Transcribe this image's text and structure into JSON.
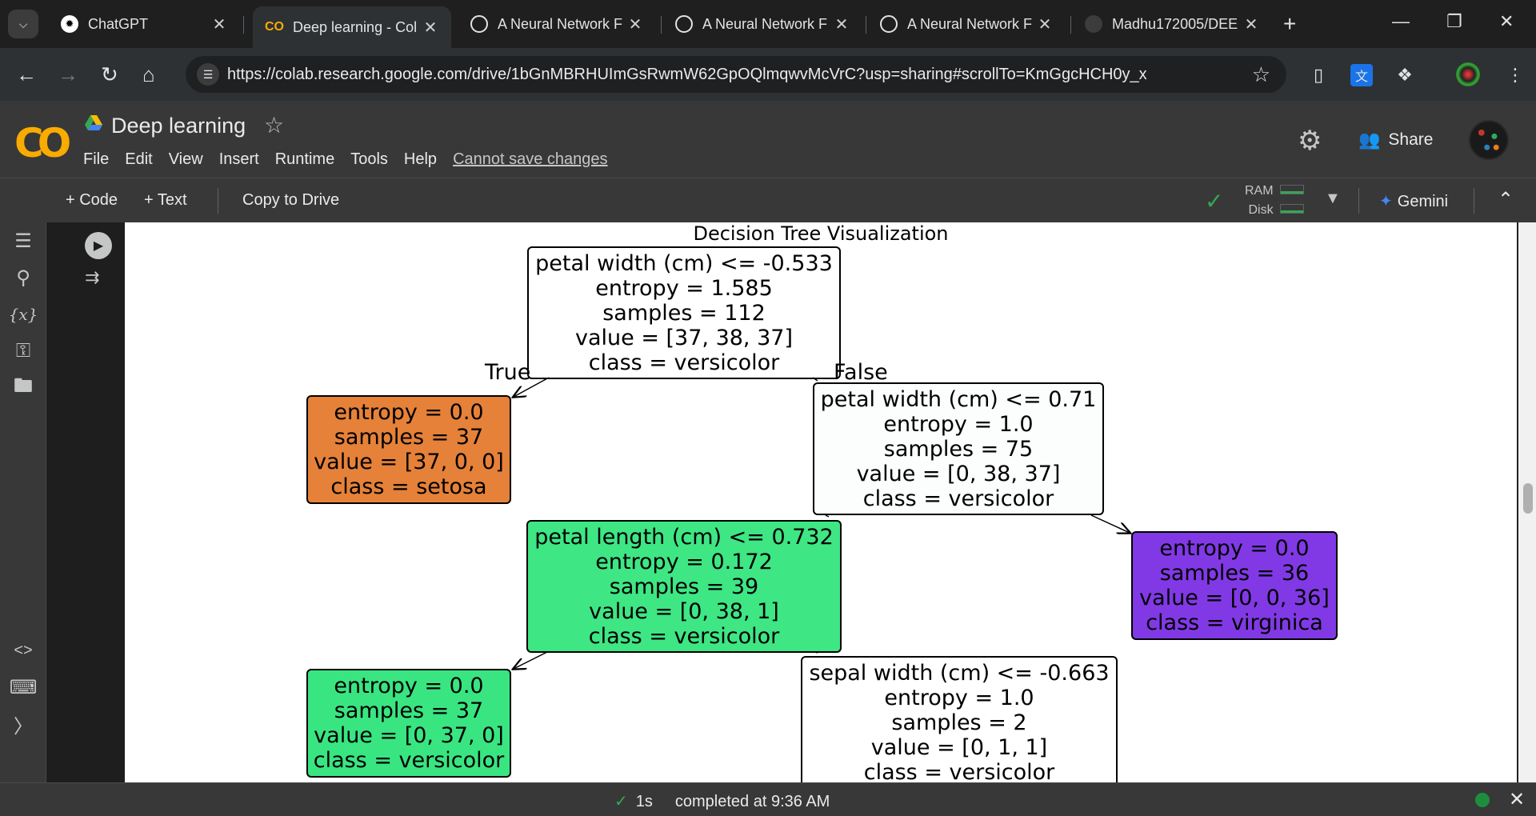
{
  "browser": {
    "tabs": [
      {
        "title": "ChatGPT",
        "icon": "chatgpt-icon",
        "active": false
      },
      {
        "title": "Deep learning - Col",
        "icon": "colab-icon",
        "active": true
      },
      {
        "title": "A Neural Network F",
        "icon": "spiral-icon",
        "active": false
      },
      {
        "title": "A Neural Network F",
        "icon": "spiral-icon",
        "active": false
      },
      {
        "title": "A Neural Network F",
        "icon": "spiral-icon",
        "active": false
      },
      {
        "title": "Madhu172005/DEE",
        "icon": "github-icon",
        "active": false
      }
    ],
    "url": "https://colab.research.google.com/drive/1bGnMBRHUImGsRwmW62GpOQlmqwvMcVrC?usp=sharing#scrollTo=KmGgcHCH0y_x"
  },
  "colab": {
    "doc_title": "Deep learning",
    "menu": [
      "File",
      "Edit",
      "View",
      "Insert",
      "Runtime",
      "Tools",
      "Help"
    ],
    "save_warning": "Cannot save changes",
    "share_label": "Share",
    "toolbar": {
      "code_label": "+ Code",
      "text_label": "+ Text",
      "copy_label": "Copy to Drive",
      "ram_label": "RAM",
      "disk_label": "Disk",
      "gemini_label": "Gemini"
    }
  },
  "output": {
    "title": "Decision Tree Visualization",
    "true_label": "True",
    "false_label": "False",
    "nodes": [
      {
        "lines": [
          "petal width (cm) <= -0.533",
          "entropy = 1.585",
          "samples = 112",
          "value = [37, 38, 37]",
          "class = versicolor"
        ],
        "fill": "#ffffff"
      },
      {
        "lines": [
          "entropy = 0.0",
          "samples = 37",
          "value = [37, 0, 0]",
          "class = setosa"
        ],
        "fill": "#e58139"
      },
      {
        "lines": [
          "petal width (cm) <= 0.71",
          "entropy = 1.0",
          "samples = 75",
          "value = [0, 38, 37]",
          "class = versicolor"
        ],
        "fill": "#fbfefc"
      },
      {
        "lines": [
          "petal length (cm) <= 0.732",
          "entropy = 0.172",
          "samples = 39",
          "value = [0, 38, 1]",
          "class = versicolor"
        ],
        "fill": "#3ee684"
      },
      {
        "lines": [
          "entropy = 0.0",
          "samples = 36",
          "value = [0, 0, 36]",
          "class = virginica"
        ],
        "fill": "#8139e5"
      },
      {
        "lines": [
          "entropy = 0.0",
          "samples = 37",
          "value = [0, 37, 0]",
          "class = versicolor"
        ],
        "fill": "#39e581"
      },
      {
        "lines": [
          "sepal width (cm) <= -0.663",
          "entropy = 1.0",
          "samples = 2",
          "value = [0, 1, 1]",
          "class = versicolor"
        ],
        "fill": "#ffffff"
      }
    ]
  },
  "status": {
    "duration": "1s",
    "message": "completed at 9:36 AM"
  }
}
